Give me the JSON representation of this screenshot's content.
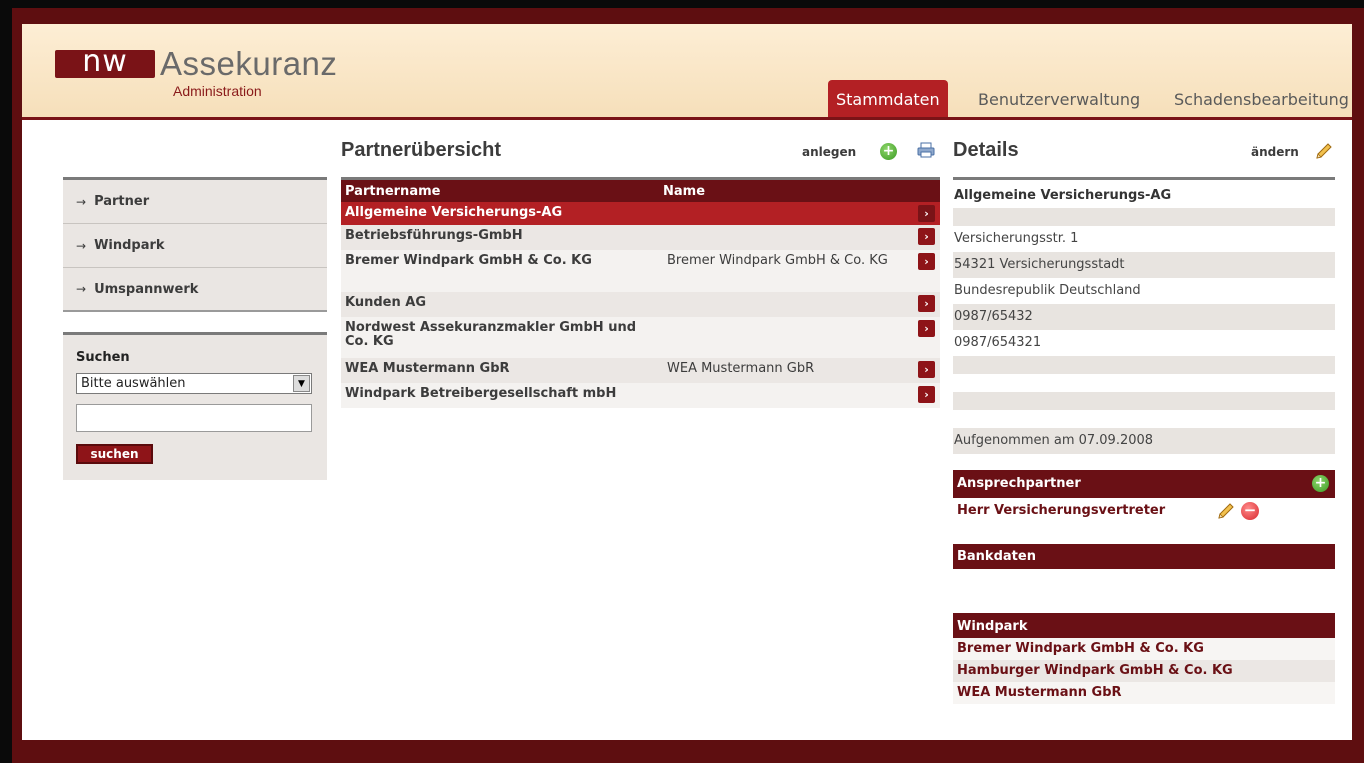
{
  "logo": {
    "mark": "nw",
    "name": "Assekuranz",
    "sub": "Administration"
  },
  "tabs": [
    {
      "label": "Stammdaten",
      "active": true
    },
    {
      "label": "Benutzerverwaltung",
      "active": false
    },
    {
      "label": "Schadensbearbeitung",
      "active": false
    }
  ],
  "sidebar": {
    "items": [
      {
        "label": "Partner"
      },
      {
        "label": "Windpark"
      },
      {
        "label": "Umspannwerk"
      }
    ],
    "search": {
      "title": "Suchen",
      "select_value": "Bitte auswählen",
      "input_value": "",
      "button_label": "suchen"
    }
  },
  "partners": {
    "title": "Partnerübersicht",
    "create_label": "anlegen",
    "columns": [
      "Partnername",
      "Name"
    ],
    "rows": [
      {
        "partnername": "Allgemeine Versicherungs-AG",
        "name": "",
        "selected": true
      },
      {
        "partnername": "Betriebsführungs-GmbH",
        "name": ""
      },
      {
        "partnername": "Bremer Windpark GmbH & Co. KG",
        "name": "Bremer Windpark GmbH & Co. KG"
      },
      {
        "partnername": "Kunden AG",
        "name": ""
      },
      {
        "partnername": "Nordwest Assekuranzmakler GmbH und Co. KG",
        "name": ""
      },
      {
        "partnername": "WEA Mustermann GbR",
        "name": "WEA Mustermann GbR"
      },
      {
        "partnername": "Windpark Betreibergesellschaft mbH",
        "name": ""
      }
    ]
  },
  "details": {
    "title": "Details",
    "edit_label": "ändern",
    "company": "Allgemeine Versicherungs-AG",
    "street": "Versicherungsstr. 1",
    "city": "54321 Versicherungsstadt",
    "country": "Bundesrepublik Deutschland",
    "phone": "0987/65432",
    "fax": "0987/654321",
    "recorded": "Aufgenommen am 07.09.2008",
    "contacts_title": "Ansprechpartner",
    "contacts": [
      "Herr Versicherungsvertreter"
    ],
    "bank_title": "Bankdaten",
    "windpark_title": "Windpark",
    "windparks": [
      "Bremer Windpark GmbH & Co. KG",
      "Hamburger Windpark GmbH & Co. KG",
      "WEA Mustermann GbR"
    ]
  },
  "colors": {
    "brand": "#7a1317",
    "accent": "#b32024",
    "header_bg": "#fdeed5"
  }
}
